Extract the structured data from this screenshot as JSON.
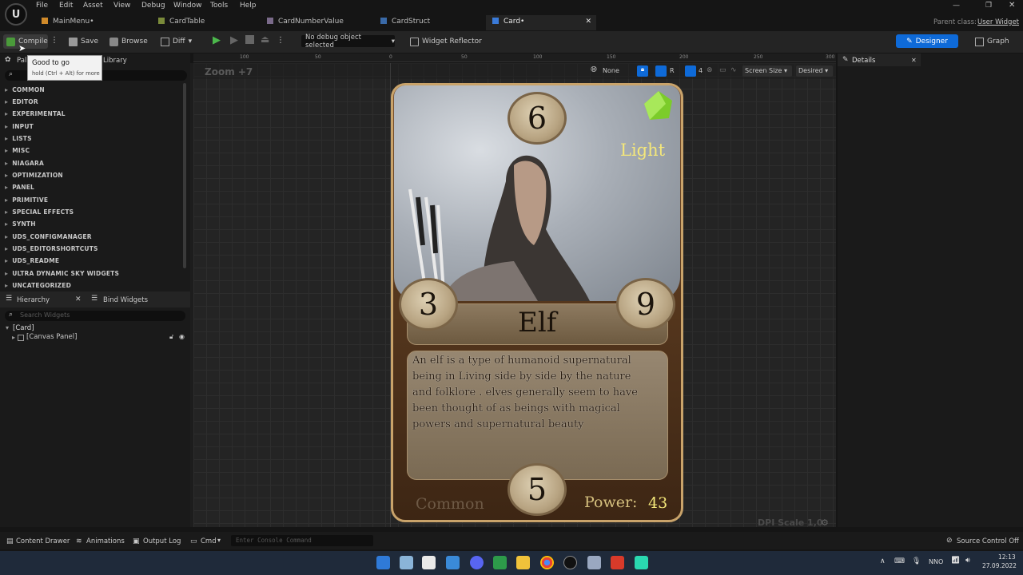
{
  "menubar": {
    "items": [
      "File",
      "Edit",
      "Asset",
      "View",
      "Debug",
      "Window",
      "Tools",
      "Help"
    ],
    "parent_class_label": "Parent class:",
    "parent_class_value": "User Widget"
  },
  "tabs": [
    "MainMenu•",
    "CardTable",
    "CardNumberValue",
    "CardStruct",
    "Card•"
  ],
  "toolbar": {
    "compile": "Compile",
    "save": "Save",
    "browse": "Browse",
    "diff": "Diff",
    "debug_object": "No debug object selected",
    "widget_reflector": "Widget Reflector",
    "designer": "Designer",
    "graph": "Graph"
  },
  "tooltip": {
    "title": "Good to go",
    "hint": "hold (Ctrl + Alt) for more"
  },
  "palette": {
    "tab_partial": "Pal",
    "library_tab": "Library",
    "categories": [
      "COMMON",
      "EDITOR",
      "EXPERIMENTAL",
      "INPUT",
      "LISTS",
      "MISC",
      "NIAGARA",
      "OPTIMIZATION",
      "PANEL",
      "PRIMITIVE",
      "SPECIAL EFFECTS",
      "SYNTH",
      "UDS_CONFIGMANAGER",
      "UDS_EDITORSHORTCUTS",
      "UDS_README",
      "ULTRA DYNAMIC SKY WIDGETS",
      "UNCATEGORIZED"
    ]
  },
  "hierarchy": {
    "tab": "Hierarchy",
    "bind_tab": "Bind Widgets",
    "search_placeholder": "Search Widgets",
    "root": "[Card]",
    "child": "[Canvas Panel]"
  },
  "viewport": {
    "zoom": "Zoom +7",
    "none_label": "None",
    "r_label": "R",
    "grid_value": "4",
    "screen_size": "Screen Size",
    "desired": "Desired",
    "dpi_scale": "DPI Scale 1,0",
    "ruler_ticks": [
      "100",
      "50",
      "0",
      "50",
      "100",
      "150",
      "200",
      "250",
      "300"
    ]
  },
  "card": {
    "top_value": "6",
    "element": "Light",
    "left_value": "3",
    "right_value": "9",
    "name": "Elf",
    "description": "An elf  is a type of humanoid supernatural being in Living side by side by the nature and folklore . elves generally seem to have been thought of as beings with magical powers and supernatural beauty",
    "bottom_value": "5",
    "rarity": "Common",
    "power_label": "Power:",
    "power_value": "43"
  },
  "details": {
    "title": "Details"
  },
  "statusbar": {
    "content_drawer": "Content Drawer",
    "animations": "Animations",
    "output_log": "Output Log",
    "cmd": "Cmd",
    "console_placeholder": "Enter Console Command",
    "source_control": "Source Control Off"
  },
  "taskbar": {
    "language": "NNO",
    "time": "12:13",
    "date": "27.09.2022"
  },
  "colors": {
    "accent_blue": "#0e6ad8",
    "card_border": "#c9a36a",
    "element_text": "#f4e77a"
  }
}
